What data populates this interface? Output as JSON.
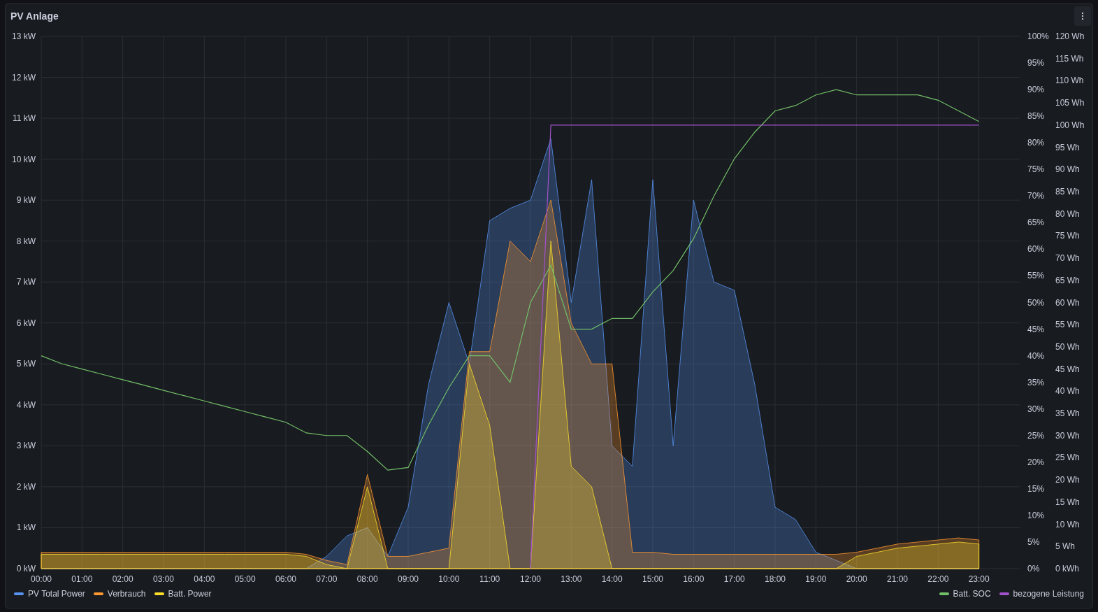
{
  "panel": {
    "title": "PV Anlage"
  },
  "chart_data": {
    "type": "area",
    "grid": true,
    "xlim": [
      0,
      24
    ],
    "ylim": [
      0,
      13
    ],
    "y2lim": [
      0,
      100
    ],
    "y3lim": [
      0,
      120
    ],
    "x": [
      0,
      0.5,
      1,
      1.5,
      2,
      2.5,
      3,
      3.5,
      4,
      4.5,
      5,
      5.5,
      6,
      6.5,
      7,
      7.5,
      8,
      8.5,
      9,
      9.5,
      10,
      10.5,
      11,
      11.5,
      12,
      12.5,
      13,
      13.5,
      14,
      14.5,
      15,
      15.5,
      16,
      16.5,
      17,
      17.5,
      18,
      18.5,
      19,
      19.5,
      20,
      20.5,
      21,
      21.5,
      22,
      22.5,
      23
    ],
    "xticks": [
      {
        "value": 0,
        "label": "00:00"
      },
      {
        "value": 1,
        "label": "01:00"
      },
      {
        "value": 2,
        "label": "02:00"
      },
      {
        "value": 3,
        "label": "03:00"
      },
      {
        "value": 4,
        "label": "04:00"
      },
      {
        "value": 5,
        "label": "05:00"
      },
      {
        "value": 6,
        "label": "06:00"
      },
      {
        "value": 7,
        "label": "07:00"
      },
      {
        "value": 8,
        "label": "08:00"
      },
      {
        "value": 9,
        "label": "09:00"
      },
      {
        "value": 10,
        "label": "10:00"
      },
      {
        "value": 11,
        "label": "11:00"
      },
      {
        "value": 12,
        "label": "12:00"
      },
      {
        "value": 13,
        "label": "13:00"
      },
      {
        "value": 14,
        "label": "14:00"
      },
      {
        "value": 15,
        "label": "15:00"
      },
      {
        "value": 16,
        "label": "16:00"
      },
      {
        "value": 17,
        "label": "17:00"
      },
      {
        "value": 18,
        "label": "18:00"
      },
      {
        "value": 19,
        "label": "19:00"
      },
      {
        "value": 20,
        "label": "20:00"
      },
      {
        "value": 21,
        "label": "21:00"
      },
      {
        "value": 22,
        "label": "22:00"
      },
      {
        "value": 23,
        "label": "23:00"
      }
    ],
    "yticks": [
      {
        "value": 0,
        "label": "0 kW"
      },
      {
        "value": 1,
        "label": "1 kW"
      },
      {
        "value": 2,
        "label": "2 kW"
      },
      {
        "value": 3,
        "label": "3 kW"
      },
      {
        "value": 4,
        "label": "4 kW"
      },
      {
        "value": 5,
        "label": "5 kW"
      },
      {
        "value": 6,
        "label": "6 kW"
      },
      {
        "value": 7,
        "label": "7 kW"
      },
      {
        "value": 8,
        "label": "8 kW"
      },
      {
        "value": 9,
        "label": "9 kW"
      },
      {
        "value": 10,
        "label": "10 kW"
      },
      {
        "value": 11,
        "label": "11 kW"
      },
      {
        "value": 12,
        "label": "12 kW"
      },
      {
        "value": 13,
        "label": "13 kW"
      }
    ],
    "y2ticks": [
      {
        "value": 0,
        "label": "0%"
      },
      {
        "value": 5,
        "label": "5%"
      },
      {
        "value": 10,
        "label": "10%"
      },
      {
        "value": 15,
        "label": "15%"
      },
      {
        "value": 20,
        "label": "20%"
      },
      {
        "value": 25,
        "label": "25%"
      },
      {
        "value": 30,
        "label": "30%"
      },
      {
        "value": 35,
        "label": "35%"
      },
      {
        "value": 40,
        "label": "40%"
      },
      {
        "value": 45,
        "label": "45%"
      },
      {
        "value": 50,
        "label": "50%"
      },
      {
        "value": 55,
        "label": "55%"
      },
      {
        "value": 60,
        "label": "60%"
      },
      {
        "value": 65,
        "label": "65%"
      },
      {
        "value": 70,
        "label": "70%"
      },
      {
        "value": 75,
        "label": "75%"
      },
      {
        "value": 80,
        "label": "80%"
      },
      {
        "value": 85,
        "label": "85%"
      },
      {
        "value": 90,
        "label": "90%"
      },
      {
        "value": 95,
        "label": "95%"
      },
      {
        "value": 100,
        "label": "100%"
      }
    ],
    "y3ticks": [
      {
        "value": 0,
        "label": "0 kWh"
      },
      {
        "value": 5,
        "label": "5 Wh"
      },
      {
        "value": 10,
        "label": "10 Wh"
      },
      {
        "value": 15,
        "label": "15 Wh"
      },
      {
        "value": 20,
        "label": "20 Wh"
      },
      {
        "value": 25,
        "label": "25 Wh"
      },
      {
        "value": 30,
        "label": "30 Wh"
      },
      {
        "value": 35,
        "label": "35 Wh"
      },
      {
        "value": 40,
        "label": "40 Wh"
      },
      {
        "value": 45,
        "label": "45 Wh"
      },
      {
        "value": 50,
        "label": "50 Wh"
      },
      {
        "value": 55,
        "label": "55 Wh"
      },
      {
        "value": 60,
        "label": "60 Wh"
      },
      {
        "value": 65,
        "label": "65 Wh"
      },
      {
        "value": 70,
        "label": "70 Wh"
      },
      {
        "value": 75,
        "label": "75 Wh"
      },
      {
        "value": 80,
        "label": "80 Wh"
      },
      {
        "value": 85,
        "label": "85 Wh"
      },
      {
        "value": 90,
        "label": "90 Wh"
      },
      {
        "value": 95,
        "label": "95 Wh"
      },
      {
        "value": 100,
        "label": "100 Wh"
      },
      {
        "value": 105,
        "label": "105 Wh"
      },
      {
        "value": 110,
        "label": "110 Wh"
      },
      {
        "value": 115,
        "label": "115 Wh"
      },
      {
        "value": 120,
        "label": "120 Wh"
      }
    ],
    "series": [
      {
        "name": "PV Total Power",
        "color": "#5794f2",
        "values": [
          0,
          0,
          0,
          0,
          0,
          0,
          0,
          0,
          0,
          0,
          0,
          0,
          0,
          0,
          0.3,
          0.8,
          1.0,
          0.3,
          1.5,
          4.5,
          6.5,
          5.0,
          8.5,
          8.8,
          9.0,
          10.5,
          6.5,
          9.5,
          3.0,
          2.5,
          9.5,
          3.0,
          9.0,
          7.0,
          6.8,
          4.5,
          1.5,
          1.2,
          0.4,
          0.2,
          0,
          0,
          0,
          0,
          0,
          0,
          0
        ]
      },
      {
        "name": "Verbrauch",
        "color": "#ff9830",
        "values": [
          0.4,
          0.4,
          0.4,
          0.4,
          0.4,
          0.4,
          0.4,
          0.4,
          0.4,
          0.4,
          0.4,
          0.4,
          0.4,
          0.35,
          0.2,
          0.1,
          2.3,
          0.3,
          0.3,
          0.4,
          0.5,
          5.3,
          5.3,
          8.0,
          7.5,
          9.0,
          6.0,
          5.0,
          5.0,
          0.4,
          0.4,
          0.35,
          0.35,
          0.35,
          0.35,
          0.35,
          0.35,
          0.35,
          0.35,
          0.35,
          0.4,
          0.5,
          0.6,
          0.65,
          0.7,
          0.75,
          0.7
        ]
      },
      {
        "name": "Batt. Power",
        "color": "#fade2a",
        "values": [
          0.35,
          0.35,
          0.35,
          0.35,
          0.35,
          0.35,
          0.35,
          0.35,
          0.35,
          0.35,
          0.35,
          0.35,
          0.35,
          0.3,
          0.1,
          0,
          2.0,
          0,
          0,
          0,
          0,
          5.0,
          3.5,
          0,
          0,
          8.0,
          2.5,
          2.0,
          0,
          0,
          0,
          0,
          0,
          0,
          0,
          0,
          0,
          0,
          0,
          0,
          0.3,
          0.4,
          0.5,
          0.55,
          0.6,
          0.65,
          0.6
        ]
      },
      {
        "name": "Batt. SOC",
        "color": "#73bf69",
        "type": "line",
        "axis": "y2",
        "values": [
          40,
          38.5,
          37.5,
          36.5,
          35.5,
          34.5,
          33.5,
          32.5,
          31.5,
          30.5,
          29.5,
          28.5,
          27.5,
          25.5,
          25,
          25,
          22,
          18.5,
          19,
          27,
          34,
          40,
          40,
          35,
          50,
          57,
          45,
          45,
          47,
          47,
          52,
          56,
          62,
          70,
          77,
          82,
          86,
          87,
          89,
          90,
          89,
          89,
          89,
          89,
          88,
          86,
          84
        ]
      },
      {
        "name": "bezogene Leistung",
        "color": "#a352cc",
        "type": "line",
        "axis": "y3",
        "values": [
          null,
          null,
          null,
          null,
          null,
          null,
          null,
          null,
          null,
          null,
          null,
          null,
          null,
          null,
          null,
          null,
          null,
          null,
          null,
          null,
          null,
          null,
          null,
          null,
          0,
          100,
          100,
          100,
          100,
          100,
          100,
          100,
          100,
          100,
          100,
          100,
          100,
          100,
          100,
          100,
          100,
          100,
          100,
          100,
          100,
          100,
          100
        ]
      }
    ]
  }
}
